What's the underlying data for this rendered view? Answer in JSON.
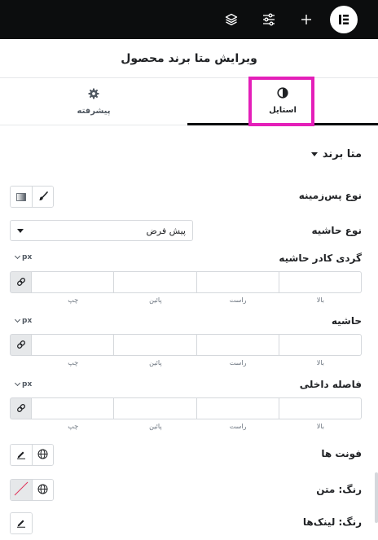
{
  "header": {
    "icons": [
      "layers-icon",
      "sliders-icon",
      "plus-icon",
      "elementor-logo-icon"
    ]
  },
  "panel": {
    "title": "ویرایش متا برند محصول"
  },
  "tabs": [
    {
      "label": "پیشرفته",
      "icon": "gear-icon",
      "active": false
    },
    {
      "label": "استایل",
      "icon": "half-circle-icon",
      "active": true
    }
  ],
  "section": {
    "title": "متا برند"
  },
  "controls": {
    "background_type": {
      "label": "نوع پس‌زمینه"
    },
    "border_type": {
      "label": "نوع حاشیه",
      "value": "پیش فرض"
    },
    "border_radius": {
      "label": "گردی کادر حاشیه",
      "unit": "px"
    },
    "margin": {
      "label": "حاشیه",
      "unit": "px"
    },
    "padding": {
      "label": "فاصله داخلی",
      "unit": "px"
    },
    "fonts": {
      "label": "فونت ها"
    },
    "text_color": {
      "label": "رنگ: متن"
    },
    "link_color": {
      "label": "رنگ: لینک‌ها"
    }
  },
  "dimension_labels": [
    "بالا",
    "راست",
    "پائین",
    "چپ"
  ],
  "colors": {
    "highlight": "#e41fb9",
    "topbar": "#0c0d0e"
  }
}
